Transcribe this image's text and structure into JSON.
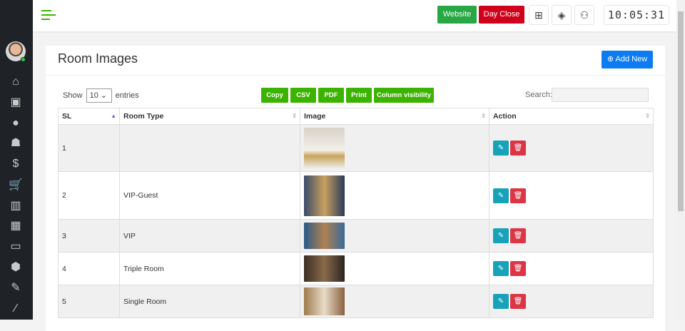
{
  "sidebar": {
    "icons": [
      "home-icon",
      "briefcase-icon",
      "user-icon",
      "users-icon",
      "dollar-icon",
      "cart-icon",
      "chart-icon",
      "grid-icon",
      "tablet-icon",
      "hexagon-icon",
      "pin-icon",
      "brush-icon"
    ]
  },
  "header": {
    "website": "Website",
    "day_close": "Day Close",
    "clock": "10:05:31"
  },
  "page": {
    "title": "Room Images",
    "add_new": "Add New"
  },
  "table_controls": {
    "show": "Show",
    "entries_value": "10",
    "entries": "entries",
    "search_label": "Search:",
    "search_value": "",
    "buttons": [
      "Copy",
      "CSV",
      "PDF",
      "Print",
      "Column visibility"
    ]
  },
  "table": {
    "headers": [
      "SL",
      "Room Type",
      "Image",
      "Action"
    ],
    "rows": [
      {
        "sl": "1",
        "room_type": ""
      },
      {
        "sl": "2",
        "room_type": "VIP-Guest"
      },
      {
        "sl": "3",
        "room_type": "VIP"
      },
      {
        "sl": "4",
        "room_type": "Triple Room"
      },
      {
        "sl": "5",
        "room_type": "Single Room"
      }
    ]
  },
  "colors": {
    "green": "#28a745",
    "red": "#d0021b",
    "blue": "#0d7cf2",
    "edit": "#17a2b8",
    "delete": "#dc3545"
  }
}
